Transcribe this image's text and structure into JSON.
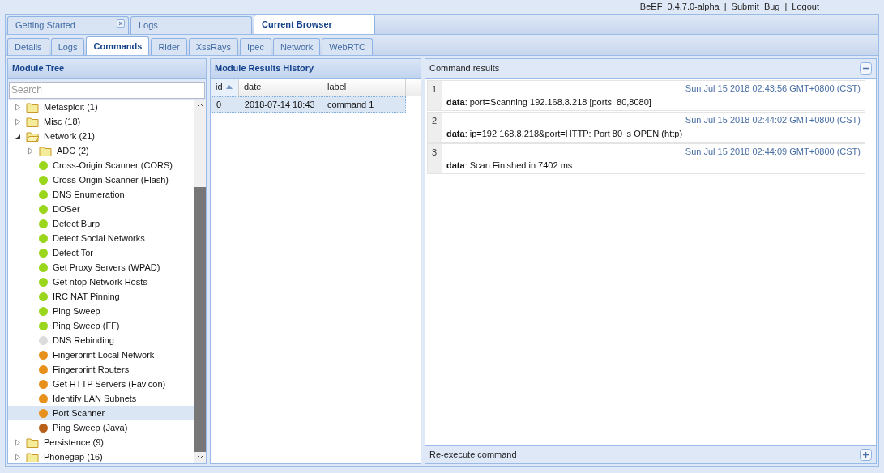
{
  "header": {
    "product": "BeEF  0.4.7.0-alpha",
    "links": [
      {
        "separator": "|",
        "label": "Submit  Bug"
      },
      {
        "separator": "|",
        "label": "Logout"
      }
    ]
  },
  "main_tabs": [
    {
      "label": "Getting Started",
      "selected": false,
      "closable": true
    },
    {
      "label": "Logs",
      "selected": false,
      "closable": false
    },
    {
      "label": "Current Browser",
      "selected": true,
      "closable": false
    }
  ],
  "sub_tabs": [
    {
      "label": "Details",
      "selected": false
    },
    {
      "label": "Logs",
      "selected": false
    },
    {
      "label": "Commands",
      "selected": true
    },
    {
      "label": "Rider",
      "selected": false
    },
    {
      "label": "XssRays",
      "selected": false
    },
    {
      "label": "Ipec",
      "selected": false
    },
    {
      "label": "Network",
      "selected": false
    },
    {
      "label": "WebRTC",
      "selected": false
    }
  ],
  "module_tree": {
    "title": "Module Tree",
    "search": {
      "placeholder": "Search"
    },
    "items": [
      {
        "kind": "folder",
        "label": "Metasploit (1)",
        "expanded": false,
        "selected": false
      },
      {
        "kind": "folder",
        "label": "Misc (18)",
        "expanded": false,
        "selected": false
      },
      {
        "kind": "folder",
        "label": "Network (21)",
        "expanded": true,
        "selected": false,
        "children": [
          {
            "kind": "folder",
            "label": "ADC (2)",
            "expanded": false,
            "selected": false
          },
          {
            "kind": "module",
            "label": "Cross-Origin Scanner (CORS)",
            "color": "#9ad61c",
            "selected": false
          },
          {
            "kind": "module",
            "label": "Cross-Origin Scanner (Flash)",
            "color": "#9ad61c",
            "selected": false
          },
          {
            "kind": "module",
            "label": "DNS Enumeration",
            "color": "#9ad61c",
            "selected": false
          },
          {
            "kind": "module",
            "label": "DOSer",
            "color": "#9ad61c",
            "selected": false
          },
          {
            "kind": "module",
            "label": "Detect Burp",
            "color": "#9ad61c",
            "selected": false
          },
          {
            "kind": "module",
            "label": "Detect Social Networks",
            "color": "#9ad61c",
            "selected": false
          },
          {
            "kind": "module",
            "label": "Detect Tor",
            "color": "#9ad61c",
            "selected": false
          },
          {
            "kind": "module",
            "label": "Get Proxy Servers (WPAD)",
            "color": "#9ad61c",
            "selected": false
          },
          {
            "kind": "module",
            "label": "Get ntop Network Hosts",
            "color": "#9ad61c",
            "selected": false
          },
          {
            "kind": "module",
            "label": "IRC NAT Pinning",
            "color": "#9ad61c",
            "selected": false
          },
          {
            "kind": "module",
            "label": "Ping Sweep",
            "color": "#9ad61c",
            "selected": false
          },
          {
            "kind": "module",
            "label": "Ping Sweep (FF)",
            "color": "#9ad61c",
            "selected": false
          },
          {
            "kind": "module",
            "label": "DNS Rebinding",
            "color": "#dcdcdc",
            "selected": false
          },
          {
            "kind": "module",
            "label": "Fingerprint Local Network",
            "color": "#e8901c",
            "selected": false
          },
          {
            "kind": "module",
            "label": "Fingerprint Routers",
            "color": "#e8901c",
            "selected": false
          },
          {
            "kind": "module",
            "label": "Get HTTP Servers (Favicon)",
            "color": "#e8901c",
            "selected": false
          },
          {
            "kind": "module",
            "label": "Identify LAN Subnets",
            "color": "#e8901c",
            "selected": false
          },
          {
            "kind": "module",
            "label": "Port Scanner",
            "color": "#e8901c",
            "selected": true
          },
          {
            "kind": "module",
            "label": "Ping Sweep (Java)",
            "color": "#b8601a",
            "selected": false
          }
        ]
      },
      {
        "kind": "folder",
        "label": "Persistence (9)",
        "expanded": false,
        "selected": false
      },
      {
        "kind": "folder",
        "label": "Phonegap (16)",
        "expanded": false,
        "selected": false
      }
    ]
  },
  "history": {
    "title": "Module Results History",
    "columns": [
      {
        "label": "id",
        "sorted": true
      },
      {
        "label": "date",
        "sorted": false
      },
      {
        "label": "label",
        "sorted": false
      }
    ],
    "rows": [
      {
        "selected": true,
        "cells": [
          "0",
          "2018-07-14 18:43",
          "command 1"
        ]
      }
    ]
  },
  "results": {
    "title": "Command results",
    "entries": [
      {
        "index": "1",
        "time": "Sun Jul 15 2018 02:43:56 GMT+0800 (CST)",
        "text": "**data**: port=Scanning 192.168.8.218 [ports: 80,8080]"
      },
      {
        "index": "2",
        "time": "Sun Jul 15 2018 02:44:02 GMT+0800 (CST)",
        "text": "**data**: ip=192.168.8.218&port=HTTP: Port 80 is OPEN (http)"
      },
      {
        "index": "3",
        "time": "Sun Jul 15 2018 02:44:09 GMT+0800 (CST)",
        "text": "**data**: Scan Finished in 7402 ms"
      }
    ],
    "footer": "Re-execute command"
  }
}
